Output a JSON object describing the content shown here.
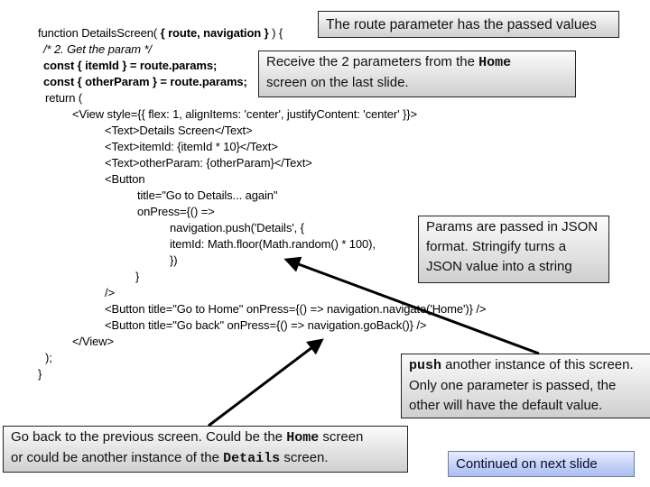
{
  "code_lines": [
    {
      "text": "function DetailsScreen( ",
      "bold_part": "{ route, navigation }",
      "tail": " ) {"
    },
    {
      "text": "/* 2. Get the param */"
    },
    {
      "text": "const { itemId } = route.params;"
    },
    {
      "text": "const { otherParam } = route.params;"
    },
    {
      "text": "return ("
    },
    {
      "text": "<View style={{ flex: 1, alignItems: 'center', justifyContent: 'center' }}>"
    },
    {
      "text": "<Text>Details Screen</Text>"
    },
    {
      "text": "<Text>itemId: {itemId * 10}</Text>"
    },
    {
      "text": "<Text>otherParam: {otherParam}</Text>"
    },
    {
      "text": "<Button"
    },
    {
      "text": "title=\"Go to Details... again\""
    },
    {
      "text": "onPress={() =>"
    },
    {
      "text": "navigation.push('Details', {"
    },
    {
      "text": "itemId: Math.floor(Math.random() * 100),"
    },
    {
      "text": "})"
    },
    {
      "text": "}"
    },
    {
      "text": "/>"
    },
    {
      "text": "<Button title=\"Go to Home\" onPress={() => navigation.navigate('Home')} />"
    },
    {
      "text": "<Button title=\"Go back\" onPress={() => navigation.goBack()} />"
    },
    {
      "text": "</View>"
    },
    {
      "text": ");"
    },
    {
      "text": "}"
    }
  ],
  "callouts": {
    "route_param": {
      "text": "The route parameter has the passed values"
    },
    "receive": {
      "pre": "Receive the 2 parameters from the ",
      "code": "Home",
      "line2": "screen on the last slide."
    },
    "json": {
      "line1": "Params are passed in JSON",
      "line2": "format.  Stringify turns a",
      "line3": "JSON value into a string"
    },
    "push": {
      "code": "push",
      "line1_rest": " another instance of this screen.",
      "line2": "Only one parameter is passed, the",
      "line3": "other will have the default value."
    },
    "goback": {
      "pre": "Go back to the previous screen.  Could be the ",
      "code1": "Home",
      "mid": " screen",
      "line2_pre": "or could be another instance of the ",
      "code2": "Details",
      "line2_post": " screen."
    }
  },
  "continued": {
    "label": "Continued on next slide"
  },
  "colors": {
    "arrow": "#000000",
    "callout_border": "#222222",
    "continued_border": "#6f7f95"
  }
}
